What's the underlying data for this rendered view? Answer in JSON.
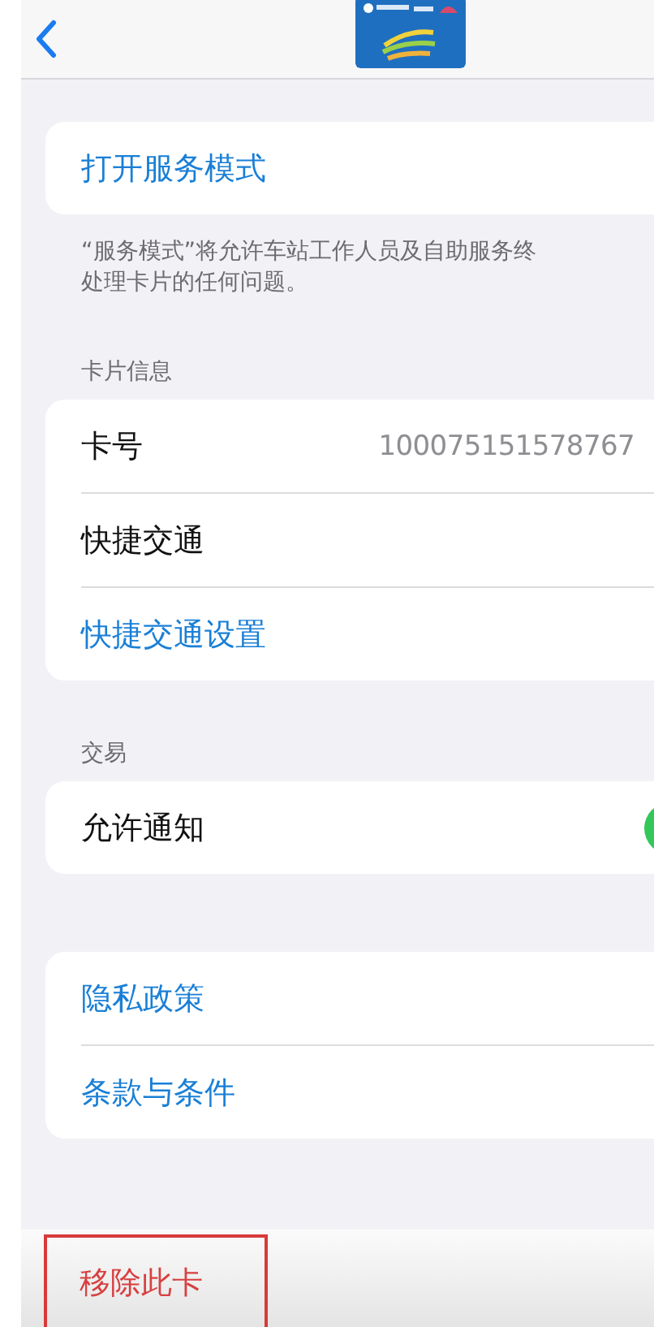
{
  "service": {
    "action": "打开服务模式",
    "footer_lines": [
      "“服务模式”将允许车站工作人员及自助服务终",
      "处理卡片的任何问题。"
    ]
  },
  "card_info": {
    "header": "卡片信息",
    "rows": [
      {
        "kind": "value",
        "label": "卡号",
        "value": "100075151578767"
      },
      {
        "kind": "plain",
        "label": "快捷交通"
      },
      {
        "kind": "link",
        "label": "快捷交通设置"
      }
    ]
  },
  "transactions": {
    "header": "交易",
    "rows": [
      {
        "kind": "toggle",
        "label": "允许通知",
        "on": true
      }
    ]
  },
  "legal": {
    "rows": [
      {
        "kind": "link",
        "label": "隐私政策"
      },
      {
        "kind": "link",
        "label": "条款与条件"
      }
    ]
  },
  "remove": {
    "label": "移除此卡",
    "highlighted": true
  }
}
